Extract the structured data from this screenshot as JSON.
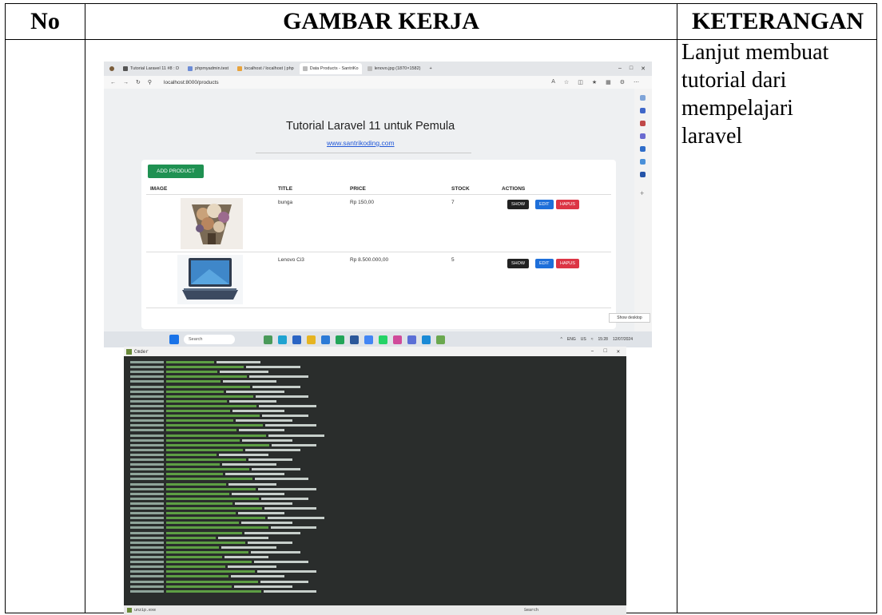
{
  "table": {
    "headers": {
      "no": "No",
      "gambar": "GAMBAR KERJA",
      "keterangan": "KETERANGAN"
    },
    "row": {
      "no": "",
      "keterangan_lines": [
        "Lanjut membuat",
        "tutorial dari",
        "mempelajari",
        "laravel"
      ]
    }
  },
  "browser": {
    "tabs": [
      "Tutorial Laravel 11 #8 : D",
      "phpmyadmin.test",
      "localhost / localhost | php",
      "Data Products - SantriKo",
      "lenovo.jpg (1870×1582)"
    ],
    "active_tab_index": 3,
    "url": "localhost:8000/products",
    "page": {
      "title": "Tutorial Laravel 11 untuk Pemula",
      "link": "www.santrikoding.com",
      "add_button": "ADD PRODUCT",
      "columns": [
        "IMAGE",
        "TITLE",
        "PRICE",
        "STOCK",
        "ACTIONS"
      ],
      "products": [
        {
          "image_icon": "flower-bouquet-photo",
          "title": "bunga",
          "price": "Rp 150,00",
          "stock": "7"
        },
        {
          "image_icon": "laptop-photo",
          "title": "Lenovo Ci3",
          "price": "Rp 8.500.000,00",
          "stock": "5"
        }
      ],
      "actions": {
        "show": "SHOW",
        "edit": "EDIT",
        "delete": "HAPUS"
      }
    },
    "show_desktop": "Show desktop",
    "taskbar": {
      "search": "Search",
      "tray_lang": "ENG",
      "tray_region": "US",
      "time": "15:28",
      "date": "12/07/2024"
    }
  },
  "terminal": {
    "title": "Cmder",
    "footer_tab": "unzip.exe",
    "footer_search": "Search"
  }
}
